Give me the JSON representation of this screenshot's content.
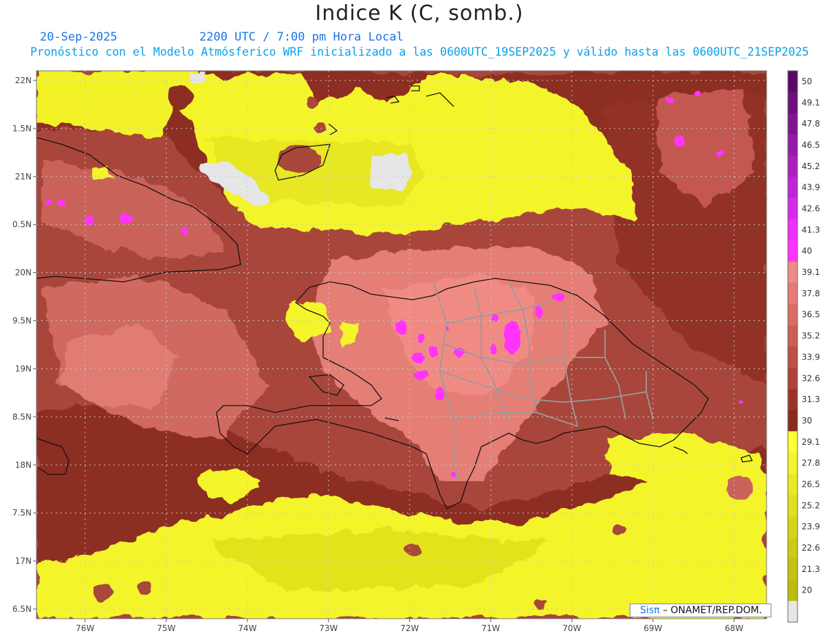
{
  "header": {
    "title": "Indice K (C, somb.)",
    "date": "20-Sep-2025",
    "time": "2200 UTC / 7:00 pm Hora Local",
    "description": "Pronóstico con el Modelo Atmósferico WRF inicializado a las 0600UTC_19SEP2025 y válido hasta las  0600UTC_21SEP2025"
  },
  "map": {
    "lat_labels": [
      "22N",
      "1.5N",
      "21N",
      "0.5N",
      "20N",
      "9.5N",
      "19N",
      "8.5N",
      "18N",
      "7.5N",
      "17N",
      "6.5N"
    ],
    "lon_labels": [
      "76W",
      "75W",
      "74W",
      "73W",
      "72W",
      "71W",
      "70W",
      "69W",
      "68W"
    ],
    "grid": true,
    "extent": {
      "lon": [
        -76.6,
        -67.6
      ],
      "lat": [
        16.4,
        22.1
      ]
    }
  },
  "legend": {
    "entries": [
      {
        "label": "50",
        "color": "#5a0a66"
      },
      {
        "label": "49.1",
        "color": "#6e0f7c"
      },
      {
        "label": "47.8",
        "color": "#821492"
      },
      {
        "label": "46.5",
        "color": "#961aa8"
      },
      {
        "label": "45.2",
        "color": "#aa1fbe"
      },
      {
        "label": "43.9",
        "color": "#c024d6"
      },
      {
        "label": "42.6",
        "color": "#d62aea"
      },
      {
        "label": "41.3",
        "color": "#ee30ff"
      },
      {
        "label": "40",
        "color": "#ff33ff"
      },
      {
        "label": "39.1",
        "color": "#f08a86"
      },
      {
        "label": "37.8",
        "color": "#e57b74"
      },
      {
        "label": "36.5",
        "color": "#d96d64"
      },
      {
        "label": "35.2",
        "color": "#cc5f55"
      },
      {
        "label": "33.9",
        "color": "#bd5047"
      },
      {
        "label": "32.6",
        "color": "#ad4239"
      },
      {
        "label": "31.3",
        "color": "#9a342b"
      },
      {
        "label": "30",
        "color": "#8a2b1f"
      },
      {
        "label": "29.1",
        "color": "#ffff33"
      },
      {
        "label": "27.8",
        "color": "#f4f42a"
      },
      {
        "label": "26.5",
        "color": "#eaea24"
      },
      {
        "label": "25.2",
        "color": "#e0e01e"
      },
      {
        "label": "23.9",
        "color": "#d6d618"
      },
      {
        "label": "22.6",
        "color": "#cccc14"
      },
      {
        "label": "21.3",
        "color": "#c3c310"
      },
      {
        "label": "20",
        "color": "#bcbc0c"
      },
      {
        "label": "",
        "color": "#e6e6e6"
      }
    ]
  },
  "credit": {
    "brand": "Sisπ",
    "text": "– ONAMET/REP.DOM."
  }
}
